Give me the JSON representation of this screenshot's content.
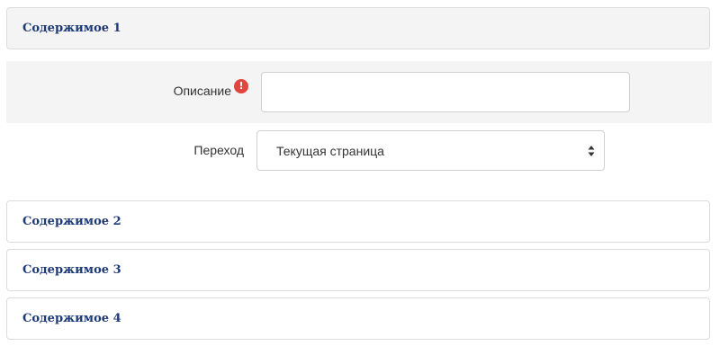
{
  "sections": {
    "section_1": "Содержимое 1",
    "section_2": "Содержимое 2",
    "section_3": "Содержимое 3",
    "section_4": "Содержимое 4"
  },
  "form": {
    "description_label": "Описание",
    "description_value": "",
    "required_mark": "!",
    "navigation_label": "Переход",
    "navigation_selected": "Текущая страница"
  },
  "colors": {
    "section_title": "#1d3a78",
    "required_icon": "#e0453f",
    "panel_background": "#f4f4f4"
  },
  "icons": {
    "required": "exclamation-circle-icon",
    "select_arrows": "sort-arrows-icon"
  }
}
